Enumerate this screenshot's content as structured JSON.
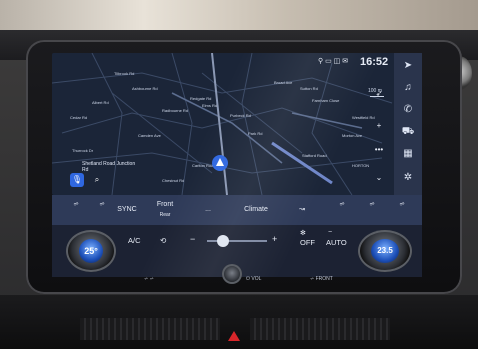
{
  "status": {
    "time": "16:52"
  },
  "map": {
    "labels": [
      "Tilbrook Rd",
      "Ashbourne Rd",
      "Albert Rd",
      "Redgate Rd",
      "Elms Rd",
      "Purbeck Rd",
      "Broad Ave",
      "Sutton Rd",
      "Cedar Rd",
      "Park Rd",
      "Westfield Rd",
      "Morton Ave",
      "Stafford Road",
      "Chestnut Rd",
      "Carlton Road",
      "HORTON",
      "Thurrock Dr",
      "Camden Ave",
      "Radbourne Rd",
      "Farnham Close"
    ],
    "scale": "100 m",
    "poi": "Shetland Road Junction",
    "poi_sub": "Rd"
  },
  "toolbar": {
    "mic_icon": "microphone-icon",
    "search_icon": "search-icon"
  },
  "sidebar": {
    "items": [
      "navigation-icon",
      "music-icon",
      "phone-icon",
      "car-icon",
      "apps-icon",
      "settings-icon"
    ]
  },
  "ribbon": {
    "sync": "SYNC",
    "front_label": "Front",
    "front_sub": "Rear",
    "dots": "...",
    "climate": "Climate"
  },
  "climate": {
    "left_temp": "25",
    "left_temp_unit": "°",
    "right_temp": "23.5",
    "ac": "A/C",
    "minus": "−",
    "plus": "+",
    "fan_off": "OFF",
    "auto": "AUTO"
  },
  "lower": {
    "vol": "VOL",
    "front": "FRONT"
  }
}
